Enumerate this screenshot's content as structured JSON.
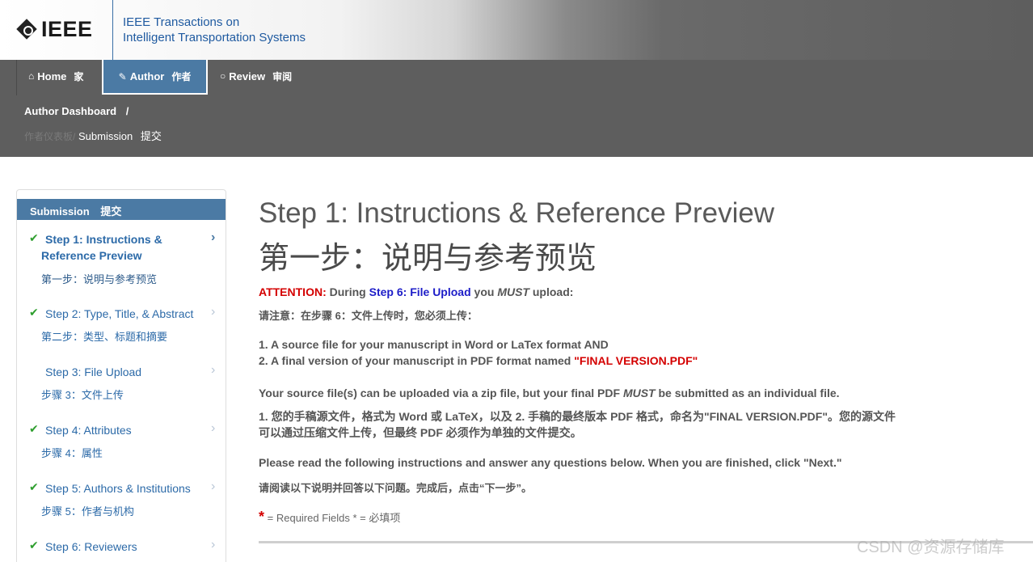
{
  "header": {
    "logo_text": "IEEE",
    "journal_line1": "IEEE Transactions on",
    "journal_line2": "Intelligent Transportation Systems"
  },
  "nav": {
    "home": {
      "label": "Home",
      "cn": "家",
      "icon": "home-icon"
    },
    "author": {
      "label": "Author",
      "cn": "作者",
      "icon": "pencil-icon"
    },
    "review": {
      "label": "Review",
      "cn": "审阅",
      "icon": "comment-icon"
    }
  },
  "breadcrumb": {
    "dashboard": "Author Dashboard",
    "slash": "/",
    "dashboard_cn": "作者仪表板",
    "slash2": "/",
    "submission": "Submission",
    "submission_cn": "提交"
  },
  "sidebar": {
    "title": "Submission",
    "title_cn": "提交",
    "steps": [
      {
        "en_line1": "Step 1: Instructions &",
        "en_line2": "Reference Preview",
        "zh": "第一步：说明与参考预览",
        "done": true,
        "active": true
      },
      {
        "en": "Step 2: Type, Title, & Abstract",
        "zh": "第二步：类型、标题和摘要",
        "done": true
      },
      {
        "en": "Step 3: File Upload",
        "zh": "步骤 3：文件上传",
        "done": false
      },
      {
        "en": "Step 4: Attributes",
        "zh": "步骤 4：属性",
        "done": true
      },
      {
        "en": "Step 5: Authors & Institutions",
        "zh": "步骤 5：作者与机构",
        "done": true
      },
      {
        "en": "Step 6: Reviewers",
        "zh": "",
        "done": true
      }
    ],
    "check_glyph": "✔",
    "chevron_glyph": "›"
  },
  "main": {
    "title_en": "Step 1: Instructions & Reference Preview",
    "title_zh": "第一步：说明与参考预览",
    "attention_label": "ATTENTION:",
    "attention_during": "During",
    "attention_step": "Step 6: File Upload",
    "attention_you": "you",
    "attention_must": "MUST",
    "attention_upload": "upload:",
    "attention_zh": "请注意：在步骤 6：文件上传时，您必须上传：",
    "item1": "1. A source file for your manuscript in Word or LaTex format AND",
    "item2_pre": "2. A final version of your manuscript in PDF format named",
    "item2_name": "\"FINAL VERSION.PDF\"",
    "source_pre": "Your source file(s) can be uploaded via a zip file, but your final PDF",
    "source_must": "MUST",
    "source_post": "be submitted as an individual file.",
    "zh_para_line1": "1. 您的手稿源文件，格式为 Word 或 LaTeX，以及 2. 手稿的最终版本 PDF 格式，命名为\"FINAL VERSION.PDF\"。您的源文件",
    "zh_para_line2": "可以通过压缩文件上传，但最终 PDF 必须作为单独的文件提交。",
    "instructions_en": "Please read the following instructions and answer any questions below. When you are finished, click \"Next.\"",
    "instructions_zh": "请阅读以下说明并回答以下问题。完成后，点击“下一步”。",
    "required_star": "*",
    "required_text": "= Required Fields  * = 必填项"
  },
  "watermark": "CSDN @资源存储库",
  "colors": {
    "nav_bg": "#5e5e5e",
    "accent": "#4b7aa4",
    "link": "#2c6aa8",
    "attention": "#d40000",
    "step_link": "#1d1dc8",
    "check": "#2e9e2e"
  }
}
